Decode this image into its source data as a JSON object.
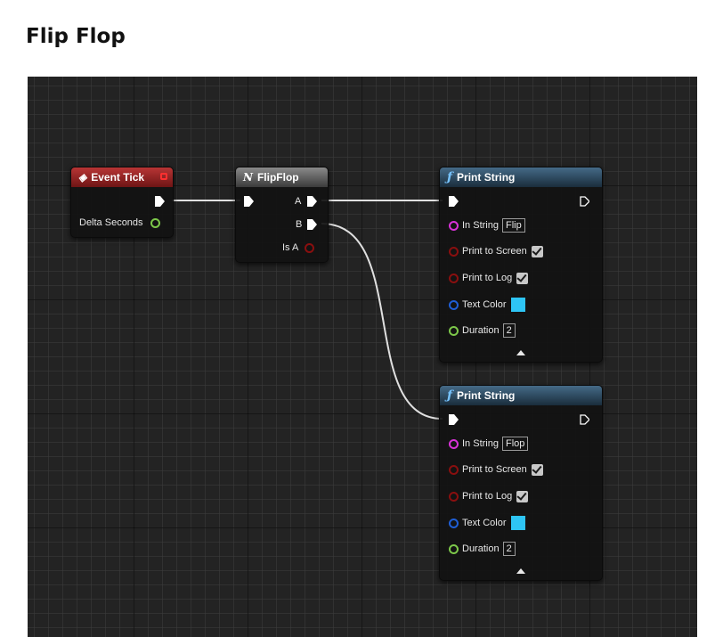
{
  "page": {
    "title": "Flip Flop"
  },
  "nodes": {
    "event_tick": {
      "title": "Event Tick",
      "icon": "event-diamond-icon",
      "outputs": {
        "delta_label": "Delta Seconds"
      }
    },
    "flipflop": {
      "title": "FlipFlop",
      "icon": "macro-icon",
      "outputs": {
        "a": "A",
        "b": "B",
        "is_a": "Is A"
      }
    },
    "print_string_1": {
      "title": "Print String",
      "icon": "function-icon",
      "in_string_label": "In String",
      "in_string_value": "Flip",
      "print_screen_label": "Print to Screen",
      "print_screen_checked": true,
      "print_log_label": "Print to Log",
      "print_log_checked": true,
      "text_color_label": "Text Color",
      "text_color_value": "#2ec5f5",
      "duration_label": "Duration",
      "duration_value": "2"
    },
    "print_string_2": {
      "title": "Print String",
      "icon": "function-icon",
      "in_string_label": "In String",
      "in_string_value": "Flop",
      "print_screen_label": "Print to Screen",
      "print_screen_checked": true,
      "print_log_label": "Print to Log",
      "print_log_checked": true,
      "text_color_label": "Text Color",
      "text_color_value": "#2ec5f5",
      "duration_label": "Duration",
      "duration_value": "2"
    }
  },
  "colors": {
    "event_header": "#a82a2a",
    "function_header": "#3a5a75",
    "string_pin": "#d932d9",
    "bool_pin": "#8a0f0f",
    "float_pin": "#7dc84a",
    "color_pin": "#1f5fd6",
    "wire": "#e0e0e0"
  }
}
